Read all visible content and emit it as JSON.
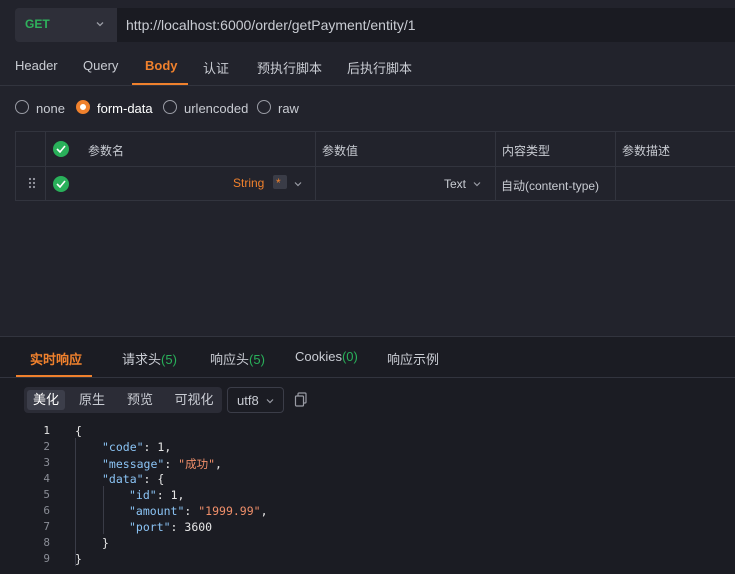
{
  "request": {
    "method": "GET",
    "url": "http://localhost:6000/order/getPayment/entity/1"
  },
  "tabs": [
    "Header",
    "Query",
    "Body",
    "认证",
    "预执行脚本",
    "后执行脚本"
  ],
  "body_modes": [
    "none",
    "form-data",
    "urlencoded",
    "raw"
  ],
  "params_table": {
    "headers": [
      "参数名",
      "参数值",
      "内容类型",
      "参数描述"
    ],
    "row": {
      "type": "String",
      "required_mark": "*",
      "value_type": "Text",
      "content_type": "自动(content-type)"
    }
  },
  "response": {
    "tabs": {
      "realtime": "实时响应",
      "req_headers": "请求头",
      "req_headers_count": "(5)",
      "resp_headers": "响应头",
      "resp_headers_count": "(5)",
      "cookies": "Cookies",
      "cookies_count": "(0)",
      "example": "响应示例"
    },
    "view_buttons": [
      "美化",
      "原生",
      "预览",
      "可视化"
    ],
    "encoding": "utf8",
    "line_numbers": [
      "1",
      "2",
      "3",
      "4",
      "5",
      "6",
      "7",
      "8",
      "9"
    ],
    "json_lines": {
      "l1": "{",
      "code_key": "\"code\"",
      "code_val": "1",
      "message_key": "\"message\"",
      "message_val": "\"成功\"",
      "data_key": "\"data\"",
      "id_key": "\"id\"",
      "id_val": "1",
      "amount_key": "\"amount\"",
      "amount_val": "\"1999.99\"",
      "port_key": "\"port\"",
      "port_val": "3600",
      "close_inner": "}",
      "close_outer": "}"
    }
  },
  "colors": {
    "accent": "#f0812d",
    "method_green": "#2fb15c",
    "check_green": "#29b05a",
    "string_value": "#f08f6a",
    "key": "#8bc4f5"
  }
}
